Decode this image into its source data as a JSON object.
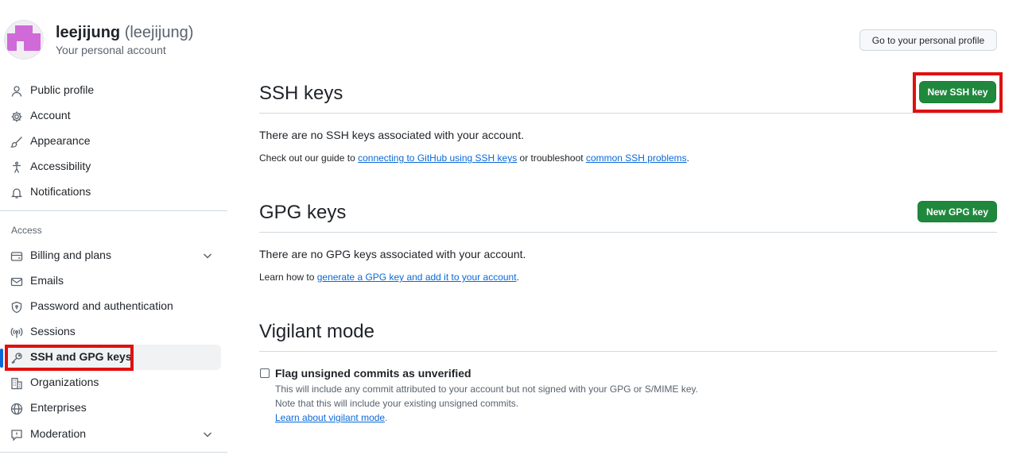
{
  "header": {
    "display_name": "leejijung",
    "handle": "(leejijung)",
    "subtitle": "Your personal account",
    "profile_button": "Go to your personal profile"
  },
  "sidebar": {
    "items": [
      {
        "label": "Public profile",
        "icon": "person-icon"
      },
      {
        "label": "Account",
        "icon": "gear-icon"
      },
      {
        "label": "Appearance",
        "icon": "paintbrush-icon"
      },
      {
        "label": "Accessibility",
        "icon": "accessibility-icon"
      },
      {
        "label": "Notifications",
        "icon": "bell-icon"
      }
    ],
    "access_label": "Access",
    "access_items": [
      {
        "label": "Billing and plans",
        "icon": "credit-card-icon",
        "expandable": true
      },
      {
        "label": "Emails",
        "icon": "mail-icon"
      },
      {
        "label": "Password and authentication",
        "icon": "shield-lock-icon"
      },
      {
        "label": "Sessions",
        "icon": "broadcast-icon"
      },
      {
        "label": "SSH and GPG keys",
        "icon": "key-icon",
        "active": true
      },
      {
        "label": "Organizations",
        "icon": "organization-icon"
      },
      {
        "label": "Enterprises",
        "icon": "globe-icon"
      },
      {
        "label": "Moderation",
        "icon": "report-icon",
        "expandable": true
      }
    ]
  },
  "ssh": {
    "title": "SSH keys",
    "new_button": "New SSH key",
    "empty": "There are no SSH keys associated with your account.",
    "guide_prefix": "Check out our guide to",
    "guide_link": "connecting to GitHub using SSH keys",
    "guide_middle": "or troubleshoot",
    "problems_link": "common SSH problems",
    "guide_suffix": "."
  },
  "gpg": {
    "title": "GPG keys",
    "new_button": "New GPG key",
    "empty": "There are no GPG keys associated with your account.",
    "learn_prefix": "Learn how to",
    "learn_link": "generate a GPG key and add it to your account",
    "learn_suffix": "."
  },
  "vigilant": {
    "title": "Vigilant mode",
    "checkbox_label": "Flag unsigned commits as unverified",
    "checked": false,
    "hint_1": "This will include any commit attributed to your account but not signed with your GPG or S/MIME key.",
    "hint_2": "Note that this will include your existing unsigned commits.",
    "learn_link": "Learn about vigilant mode",
    "learn_suffix": "."
  },
  "colors": {
    "accent": "#0969da",
    "primary_button": "#1f883d",
    "highlight_box": "#e01010",
    "avatar": "#cf6ad8"
  }
}
